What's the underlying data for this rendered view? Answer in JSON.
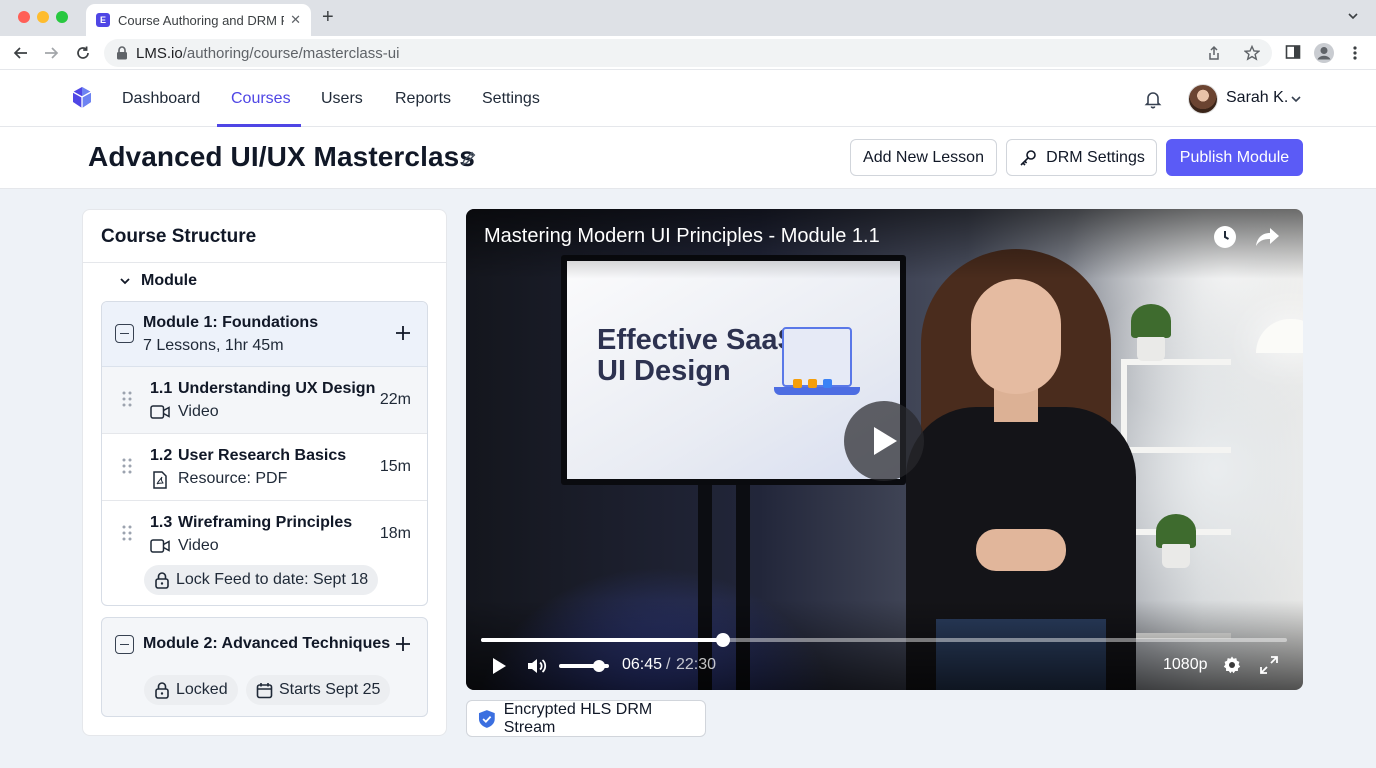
{
  "browser": {
    "tab_title": "Course Authoring and DRM P",
    "tab_favicon_letter": "E",
    "url_domain": "LMS.io",
    "url_path": "/authoring/course/masterclass-ui"
  },
  "app_nav": {
    "items": [
      {
        "label": "Dashboard",
        "active": false
      },
      {
        "label": "Courses",
        "active": true
      },
      {
        "label": "Users",
        "active": false
      },
      {
        "label": "Reports",
        "active": false
      },
      {
        "label": "Settings",
        "active": false
      }
    ],
    "user_name": "Sarah K."
  },
  "page": {
    "title": "Advanced UI/UX Masterclass",
    "buttons": {
      "add_lesson": "Add New Lesson",
      "drm_settings": "DRM Settings",
      "publish": "Publish Module"
    },
    "accent_color": "#5b5bf6"
  },
  "course_structure": {
    "title": "Course Structure",
    "group_label": "Module",
    "modules": [
      {
        "name": "Module 1: Foundations",
        "meta": "7 Lessons, 1hr 45m",
        "lessons": [
          {
            "num": "1.1",
            "name": "Understanding UX Design",
            "type": "Video",
            "type_icon": "video-icon",
            "duration": "22m"
          },
          {
            "num": "1.2",
            "name": "User Research Basics",
            "type": "Resource: PDF",
            "type_icon": "pdf-icon",
            "duration": "15m"
          },
          {
            "num": "1.3",
            "name": "Wireframing Principles",
            "type": "Video",
            "type_icon": "video-icon",
            "duration": "18m",
            "lock_label": "Lock Feed to date: Sept 18"
          }
        ]
      },
      {
        "name": "Module 2: Advanced Techniques",
        "status": "Locked",
        "start": "Starts Sept 25"
      }
    ]
  },
  "player": {
    "title": "Mastering Modern UI Principles - Module 1.1",
    "slide_text_line1": "Effective SaaS",
    "slide_text_line2": "UI Design",
    "current_time": "06:45",
    "time_separator": "/",
    "duration": "22:30",
    "progress": 0.3,
    "volume": 0.8,
    "quality": "1080p",
    "drm_label": "Encrypted HLS DRM Stream"
  }
}
